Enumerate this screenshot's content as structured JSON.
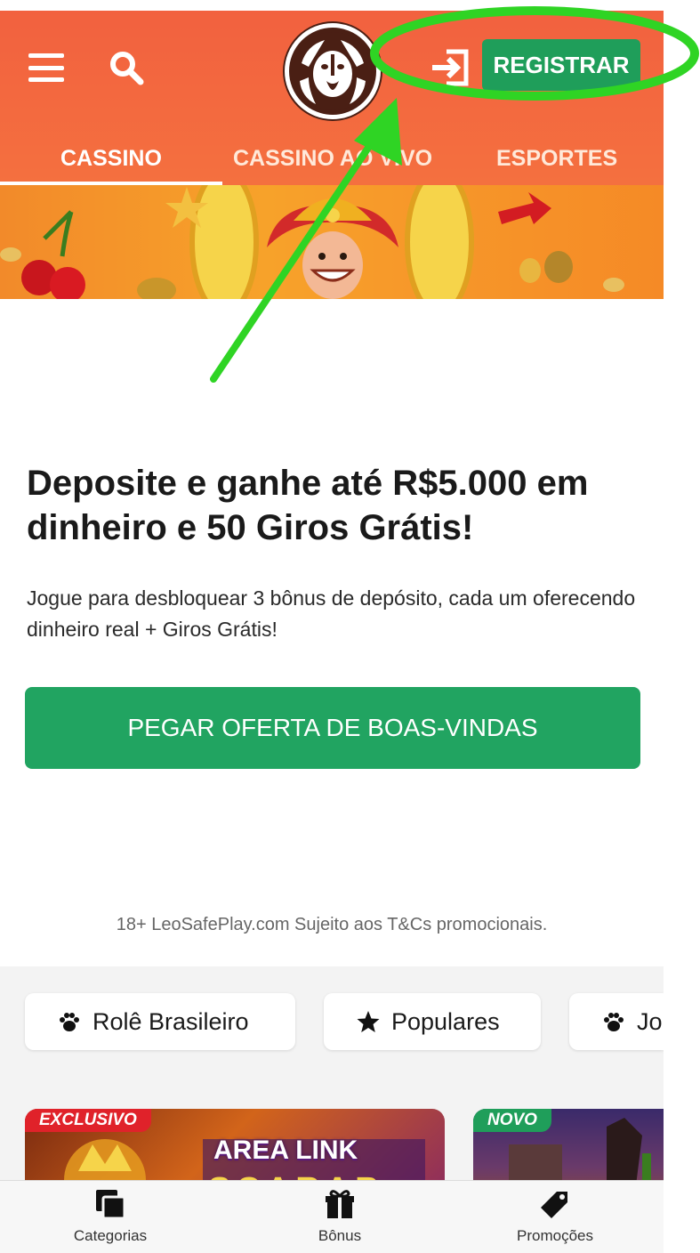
{
  "header": {
    "menu_icon": "hamburger-menu-icon",
    "search_icon": "search-icon",
    "logo_icon": "lion-logo-icon",
    "login_icon": "login-arrow-icon",
    "register_label": "REGISTRAR"
  },
  "tabs": [
    {
      "label": "CASSINO",
      "active": true
    },
    {
      "label": "CASSINO AO VIVO",
      "active": false
    },
    {
      "label": "ESPORTES",
      "active": false
    }
  ],
  "promo": {
    "title": "Deposite e ganhe até R$5.000 em dinheiro e 50 Giros Grátis!",
    "description": "Jogue para desbloquear 3 bônus de depósito, cada um oferecendo dinheiro real + Giros Grátis!",
    "cta_label": "PEGAR OFERTA DE BOAS-VINDAS",
    "legal": "18+ LeoSafePlay.com Sujeito aos T&Cs promocionais."
  },
  "categories": [
    {
      "label": "Rolê Brasileiro",
      "icon": "paw-icon"
    },
    {
      "label": "Populares",
      "icon": "star-icon"
    },
    {
      "label": "Jo",
      "icon": "paw-icon"
    }
  ],
  "games": [
    {
      "tag": "EXCLUSIVO",
      "title": "AREA LINK",
      "subtitle": "SCARAB"
    },
    {
      "tag": "NOVO"
    }
  ],
  "bottom_nav": [
    {
      "label": "Categorias",
      "icon": "categories-icon"
    },
    {
      "label": "Bônus",
      "icon": "gift-icon"
    },
    {
      "label": "Promoções",
      "icon": "tag-icon"
    }
  ],
  "colors": {
    "header": "#f2613f",
    "green": "#21a461",
    "annotation": "#2fd424"
  }
}
